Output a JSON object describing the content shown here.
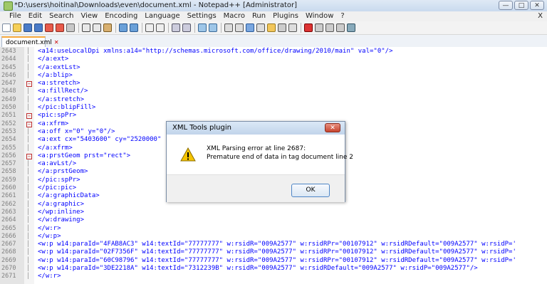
{
  "window": {
    "title": "*D:\\users\\hoitinal\\Downloads\\even\\document.xml - Notepad++ [Administrator]",
    "buttons": {
      "minimize": "—",
      "maximize": "□",
      "close": "✕"
    }
  },
  "menu": {
    "items": [
      "File",
      "Edit",
      "Search",
      "View",
      "Encoding",
      "Language",
      "Settings",
      "Macro",
      "Run",
      "Plugins",
      "Window",
      "?"
    ],
    "close": "X"
  },
  "tab": {
    "label": "document.xml",
    "close": "✕"
  },
  "editor": {
    "lines": [
      {
        "n": "2643",
        "code": "<a14:useLocalDpi xmlns:a14=\"http://schemas.microsoft.com/office/drawing/2010/main\" val=\"0\"/>"
      },
      {
        "n": "2644",
        "code": "</a:ext>"
      },
      {
        "n": "2645",
        "code": "</a:extLst>"
      },
      {
        "n": "2646",
        "code": "</a:blip>"
      },
      {
        "n": "2647",
        "code": "<a:stretch>"
      },
      {
        "n": "2648",
        "code": "<a:fillRect/>"
      },
      {
        "n": "2649",
        "code": "</a:stretch>"
      },
      {
        "n": "2650",
        "code": "</pic:blipFill>"
      },
      {
        "n": "2651",
        "code": "<pic:spPr>"
      },
      {
        "n": "2652",
        "code": "<a:xfrm>"
      },
      {
        "n": "2653",
        "code": "<a:off x=\"0\" y=\"0\"/>"
      },
      {
        "n": "2654",
        "code": "<a:ext cx=\"5403600\" cy=\"2520000\""
      },
      {
        "n": "2655",
        "code": "</a:xfrm>"
      },
      {
        "n": "2656",
        "code": "<a:prstGeom prst=\"rect\">"
      },
      {
        "n": "2657",
        "code": "<a:avLst/>"
      },
      {
        "n": "2658",
        "code": "</a:prstGeom>"
      },
      {
        "n": "2659",
        "code": "</pic:spPr>"
      },
      {
        "n": "2660",
        "code": "</pic:pic>"
      },
      {
        "n": "2661",
        "code": "</a:graphicData>"
      },
      {
        "n": "2662",
        "code": "</a:graphic>"
      },
      {
        "n": "2663",
        "code": "</wp:inline>"
      },
      {
        "n": "2664",
        "code": "</w:drawing>"
      },
      {
        "n": "2665",
        "code": "</w:r>"
      },
      {
        "n": "2666",
        "code": "</w:p>"
      },
      {
        "n": "2667",
        "code": "<w:p w14:paraId=\"4FAB8AC3\" w14:textId=\"77777777\" w:rsidR=\"009A2577\" w:rsidRPr=\"00107912\" w:rsidRDefault=\"009A2577\" w:rsidP='"
      },
      {
        "n": "2668",
        "code": "<w:p w14:paraId=\"02F7356F\" w14:textId=\"77777777\" w:rsidR=\"009A2577\" w:rsidRPr=\"00107912\" w:rsidRDefault=\"009A2577\" w:rsidP='"
      },
      {
        "n": "2669",
        "code": "<w:p w14:paraId=\"60C98796\" w14:textId=\"77777777\" w:rsidR=\"009A2577\" w:rsidRPr=\"00107912\" w:rsidRDefault=\"009A2577\" w:rsidP='"
      },
      {
        "n": "2670",
        "code": "<w:p w14:paraId=\"3DE2218A\" w14:textId=\"7312239B\" w:rsidR=\"009A2577\" w:rsidRDefault=\"009A2577\" w:rsidP=\"009A2577\"/>"
      },
      {
        "n": "2671",
        "code": "</w:r>"
      }
    ]
  },
  "dialog": {
    "title": "XML Tools plugin",
    "close": "✕",
    "message_line1": "XML Parsing error at line 2687:",
    "message_line2": "Premature end of data in tag document line 2",
    "ok_label": "OK",
    "icon": "warning-icon"
  },
  "colors": {
    "code_text": "#0000ff",
    "tab_accent": "#f7a83c",
    "dialog_close": "#c7442e"
  }
}
